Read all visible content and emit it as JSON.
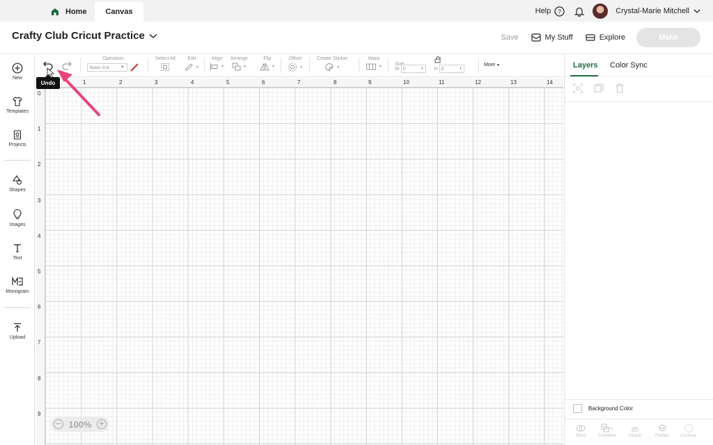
{
  "topbar": {
    "tabs": [
      {
        "label": "Home"
      },
      {
        "label": "Canvas"
      }
    ],
    "help_label": "Help",
    "user_name": "Crystal-Marie Mitchell"
  },
  "header": {
    "project_title": "Crafty Club Cricut Practice",
    "save_label": "Save",
    "my_stuff_label": "My Stuff",
    "explore_label": "Explore",
    "make_label": "Make"
  },
  "sidebar": {
    "items": [
      {
        "label": "New",
        "icon": "plus-circle-icon"
      },
      {
        "label": "Templates",
        "icon": "shirt-icon"
      },
      {
        "label": "Projects",
        "icon": "projects-icon"
      },
      {
        "label": "Shapes",
        "icon": "shapes-icon"
      },
      {
        "label": "Images",
        "icon": "lightbulb-icon"
      },
      {
        "label": "Text",
        "icon": "text-icon"
      },
      {
        "label": "Monogram",
        "icon": "monogram-icon"
      },
      {
        "label": "Upload",
        "icon": "upload-icon"
      }
    ]
  },
  "toolbar": {
    "operation_label": "Operation",
    "operation_value": "Basic Cut",
    "select_all_label": "Select All",
    "edit_label": "Edit",
    "align_label": "Align",
    "arrange_label": "Arrange",
    "flip_label": "Flip",
    "offset_label": "Offset",
    "create_sticker_label": "Create Sticker",
    "warp_label": "Warp",
    "size_label": "Size",
    "size_w_label": "W",
    "size_h_label": "H",
    "size_w_value": "0",
    "size_h_value": "0",
    "more_label": "More",
    "tooltip": "Undo"
  },
  "canvas": {
    "ruler_x": [
      "1",
      "2",
      "3",
      "4",
      "5",
      "6",
      "7",
      "8",
      "9",
      "10",
      "11",
      "12",
      "13",
      "14"
    ],
    "ruler_y": [
      "0",
      "1",
      "2",
      "3",
      "4",
      "5",
      "6",
      "7",
      "8",
      "9"
    ],
    "zoom_level": "100%"
  },
  "right_panel": {
    "tabs": [
      {
        "label": "Layers"
      },
      {
        "label": "Color Sync"
      }
    ],
    "background_color_label": "Background Color",
    "bottom_tools": [
      {
        "label": "Slice"
      },
      {
        "label": "Combine"
      },
      {
        "label": "Attach"
      },
      {
        "label": "Flatten"
      },
      {
        "label": "Contour"
      }
    ]
  },
  "colors": {
    "accent_green": "#1b6a44",
    "annotation_pink": "#e8427c",
    "make_button_disabled": "#e4e4e4"
  }
}
